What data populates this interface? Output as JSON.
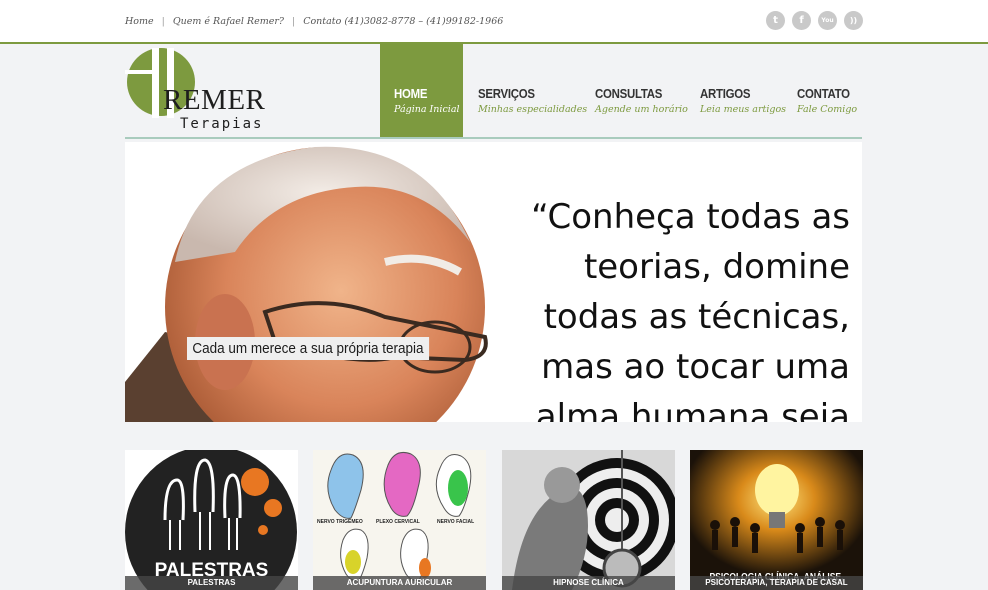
{
  "topbar": {
    "links": [
      "Home",
      "Quem é Rafael Remer?",
      "Contato (41)3082-8778 – (41)99182-1966"
    ],
    "social": [
      {
        "icon": "twitter-icon",
        "glyph": "t"
      },
      {
        "icon": "facebook-icon",
        "glyph": "f"
      },
      {
        "icon": "youtube-icon",
        "glyph": "You"
      },
      {
        "icon": "rss-icon",
        "glyph": "))"
      }
    ]
  },
  "logo": {
    "name": "REMER",
    "tagline": "Terapias"
  },
  "nav": [
    {
      "title": "HOME",
      "subtitle": "Página Inicial",
      "active": true
    },
    {
      "title": "SERVIÇOS",
      "subtitle": "Minhas especialidades",
      "active": false
    },
    {
      "title": "CONSULTAS",
      "subtitle": "Agende um horário",
      "active": false
    },
    {
      "title": "ARTIGOS",
      "subtitle": "Leia meus artigos",
      "active": false
    },
    {
      "title": "CONTATO",
      "subtitle": "Fale Comigo",
      "active": false
    }
  ],
  "hero": {
    "caption": "Cada um merece a sua própria terapia",
    "quote": "“Conheça todas as teorias, domine todas as técnicas, mas ao tocar uma alma humana seja"
  },
  "cards": [
    {
      "label": "PALESTRAS",
      "bar": "PALESTRAS"
    },
    {
      "ear_labels": [
        "NERVO TRIGÊMEO",
        "PLEXO CERVICAL",
        "NERVO FACIAL"
      ],
      "bar": "ACUPUNTURA AURICULAR"
    },
    {
      "bar": "HIPNOSE CLÍNICA"
    },
    {
      "label": "PSICOLOGIA CLÍNICA, ANÁLISE,",
      "bar": "PSICOTERAPIA, TERAPIA DE CASAL"
    }
  ],
  "colors": {
    "accent": "#7d9a3f",
    "nav_underline": "#a9cbbd"
  }
}
